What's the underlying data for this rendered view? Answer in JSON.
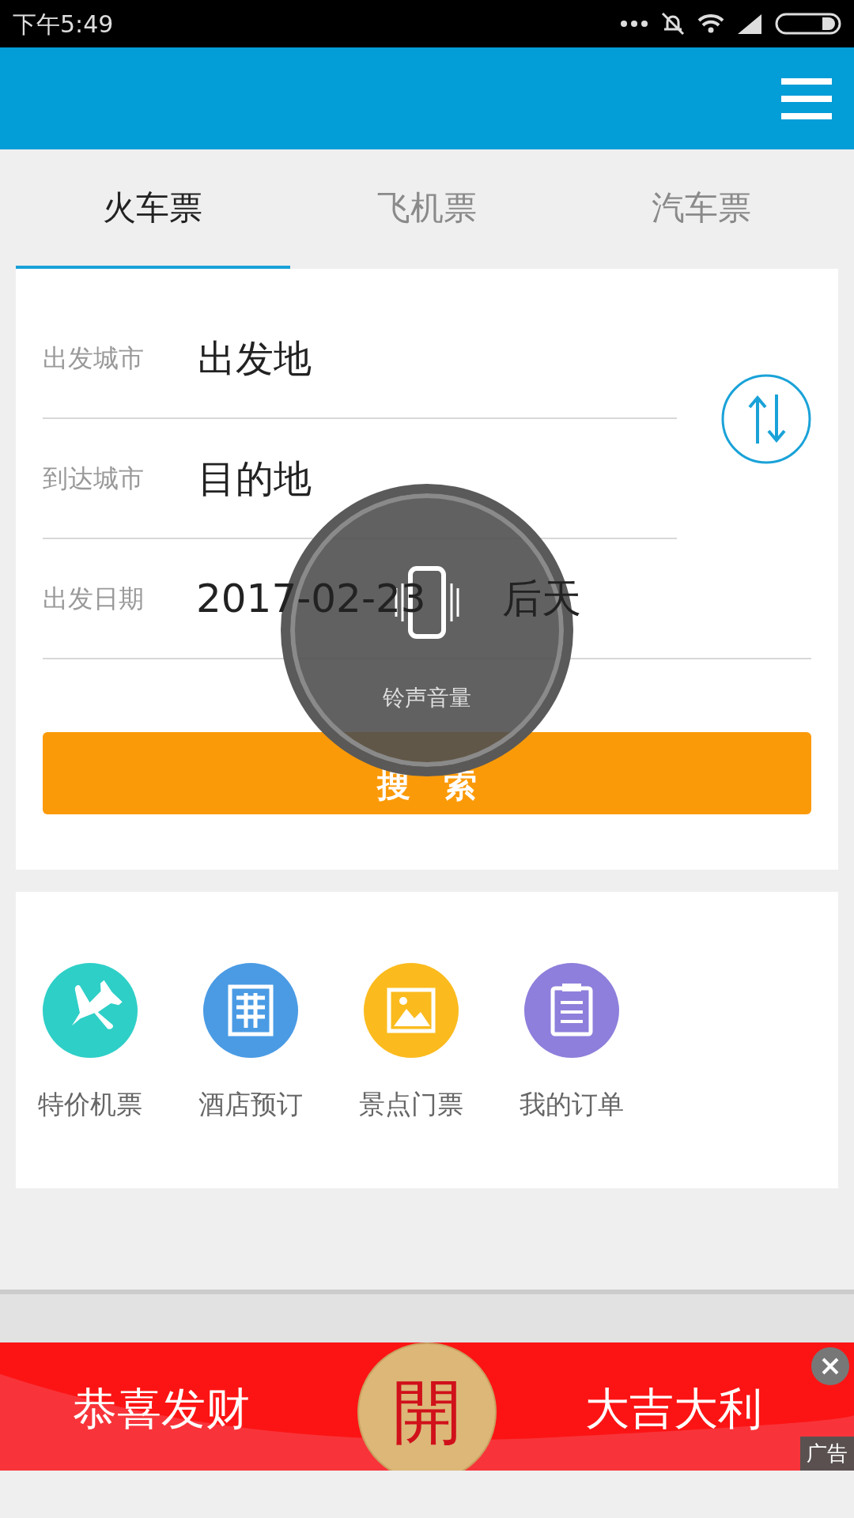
{
  "status_bar": {
    "time": "下午5:49"
  },
  "tabs": [
    {
      "label": "火车票",
      "selected": true
    },
    {
      "label": "飞机票",
      "selected": false
    },
    {
      "label": "汽车票",
      "selected": false
    }
  ],
  "form": {
    "fields": [
      {
        "label": "出发城市",
        "placeholder": "出发地"
      },
      {
        "label": "到达城市",
        "placeholder": "目的地"
      }
    ],
    "date": {
      "label": "出发日期",
      "value": "2017-02-23",
      "note": "后天"
    },
    "search_button": "搜　索"
  },
  "services": [
    {
      "label": "特价机票",
      "color": "#2ecfc7"
    },
    {
      "label": "酒店预订",
      "color": "#4a9be4"
    },
    {
      "label": "景点门票",
      "color": "#fbbb1e"
    },
    {
      "label": "我的订单",
      "color": "#8d7fdb"
    }
  ],
  "volume_overlay": {
    "label": "铃声音量"
  },
  "ad": {
    "left_text": "恭喜发财",
    "coin_text": "開",
    "right_text": "大吉大利",
    "tag": "广告"
  }
}
